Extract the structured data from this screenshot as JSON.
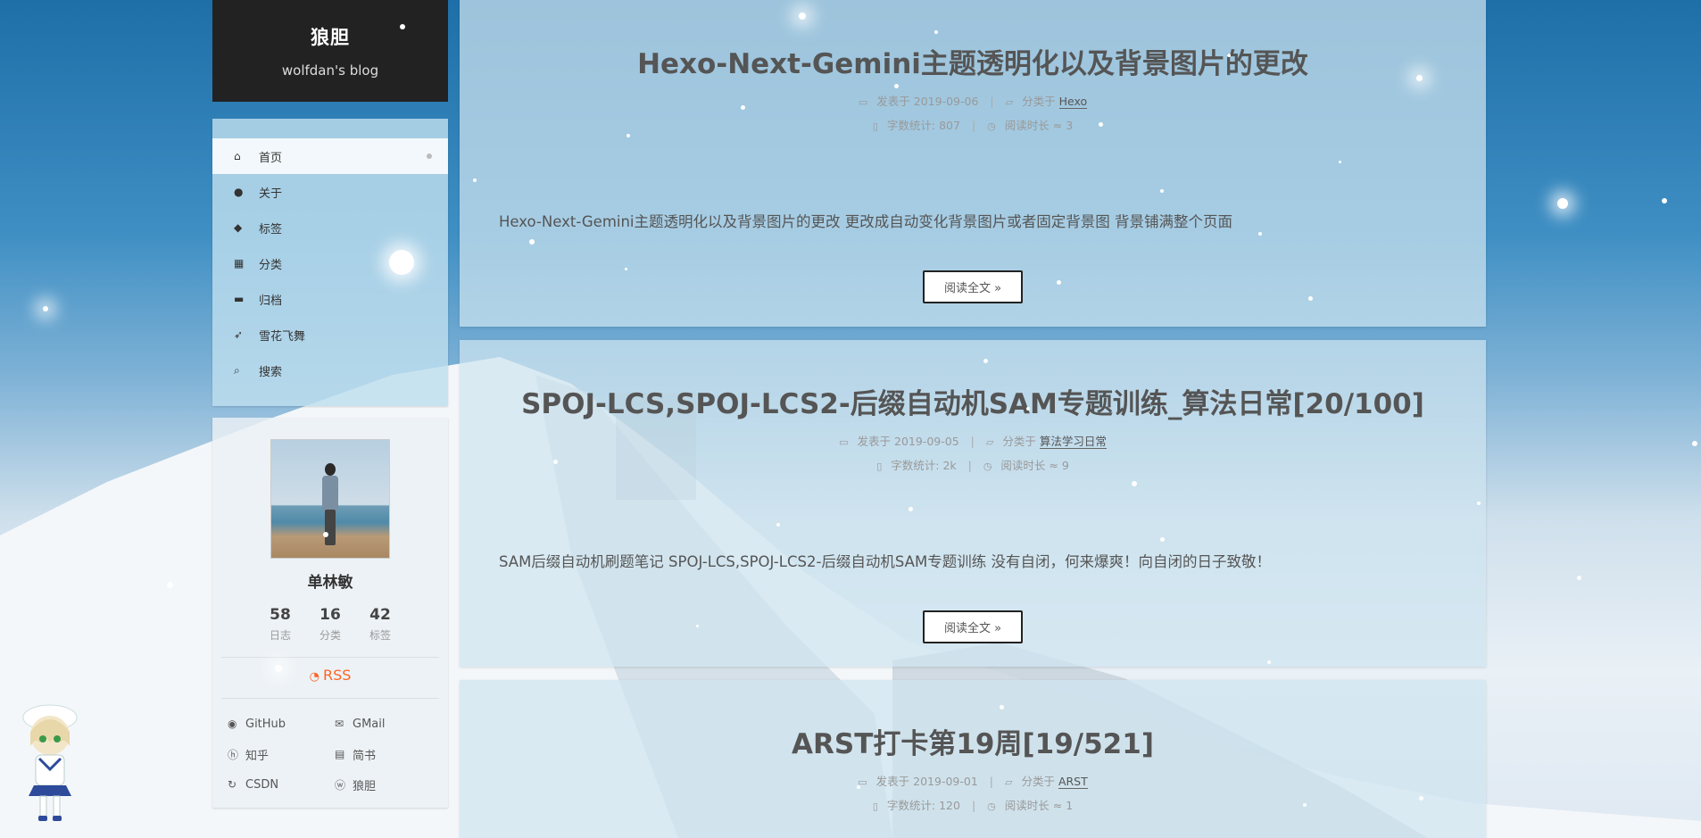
{
  "site": {
    "title": "狼胆",
    "subtitle": "wolfdan's blog"
  },
  "menu": [
    {
      "label": "首页",
      "icon": "home-icon",
      "glyph": "⌂",
      "active": true
    },
    {
      "label": "关于",
      "icon": "user-icon",
      "glyph": "●",
      "active": false
    },
    {
      "label": "标签",
      "icon": "tags-icon",
      "glyph": "◆",
      "active": false
    },
    {
      "label": "分类",
      "icon": "grid-icon",
      "glyph": "▦",
      "active": false
    },
    {
      "label": "归档",
      "icon": "archive-icon",
      "glyph": "▬",
      "active": false
    },
    {
      "label": "雪花飞舞",
      "icon": "rocket-icon",
      "glyph": "➶",
      "active": false
    },
    {
      "label": "搜索",
      "icon": "search-icon",
      "glyph": "⌕",
      "active": false
    }
  ],
  "profile": {
    "name": "单林敏",
    "stats": [
      {
        "num": "58",
        "label": "日志"
      },
      {
        "num": "16",
        "label": "分类"
      },
      {
        "num": "42",
        "label": "标签"
      }
    ],
    "rss": "RSS",
    "links": [
      {
        "label": "GitHub",
        "icon": "github-icon",
        "glyph": "◉"
      },
      {
        "label": "GMail",
        "icon": "mail-icon",
        "glyph": "✉"
      },
      {
        "label": "知乎",
        "icon": "zhihu-icon",
        "glyph": "ⓗ"
      },
      {
        "label": "简书",
        "icon": "book-icon",
        "glyph": "▤"
      },
      {
        "label": "CSDN",
        "icon": "refresh-icon",
        "glyph": "↻"
      },
      {
        "label": "狼胆",
        "icon": "wordpress-icon",
        "glyph": "ⓦ"
      }
    ]
  },
  "meta_labels": {
    "posted": "发表于",
    "category": "分类于",
    "words": "字数统计:",
    "read_time": "阅读时长 ≈",
    "sep": "|"
  },
  "posts": [
    {
      "title": "Hexo-Next-Gemini主题透明化以及背景图片的更改",
      "date": "2019-09-06",
      "category": "Hexo",
      "words": "807",
      "read_time": "3",
      "excerpt": "Hexo-Next-Gemini主题透明化以及背景图片的更改 更改成自动变化背景图片或者固定背景图 背景铺满整个页面",
      "read_more": "阅读全文 »"
    },
    {
      "title": "SPOJ-LCS,SPOJ-LCS2-后缀自动机SAM专题训练_算法日常[20/100]",
      "date": "2019-09-05",
      "category": "算法学习日常",
      "words": "2k",
      "read_time": "9",
      "excerpt": "SAM后缀自动机刷题笔记 SPOJ-LCS,SPOJ-LCS2-后缀自动机SAM专题训练 没有自闭，何来爆爽！向自闭的日子致敬！",
      "read_more": "阅读全文 »"
    },
    {
      "title": "ARST打卡第19周[19/521]",
      "date": "2019-09-01",
      "category": "ARST",
      "words": "120",
      "read_time": "1"
    }
  ]
}
